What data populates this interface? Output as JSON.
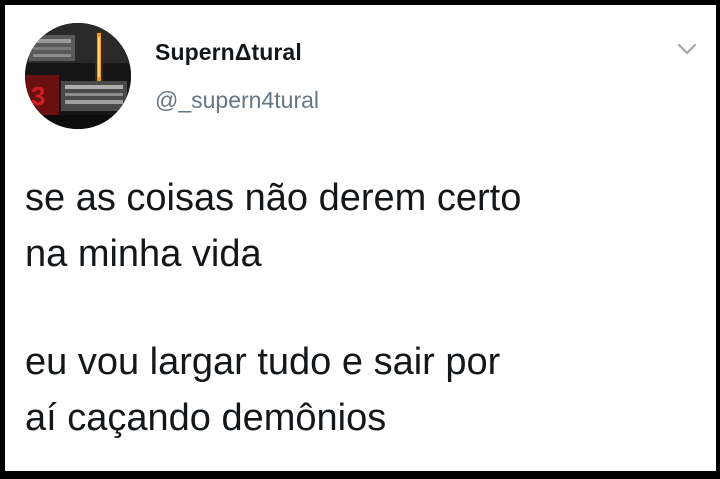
{
  "tweet": {
    "author": {
      "display_name": "SupernΔtural",
      "handle": "@_supern4tural",
      "avatar_icon": "profile-avatar-image"
    },
    "menu_icon": "chevron-down-icon",
    "paragraphs": [
      {
        "lines": [
          "se as coisas não derem certo",
          "na minha vida"
        ]
      },
      {
        "lines": [
          "eu vou largar tudo e sair por",
          "aí caçando demônios"
        ]
      }
    ]
  }
}
